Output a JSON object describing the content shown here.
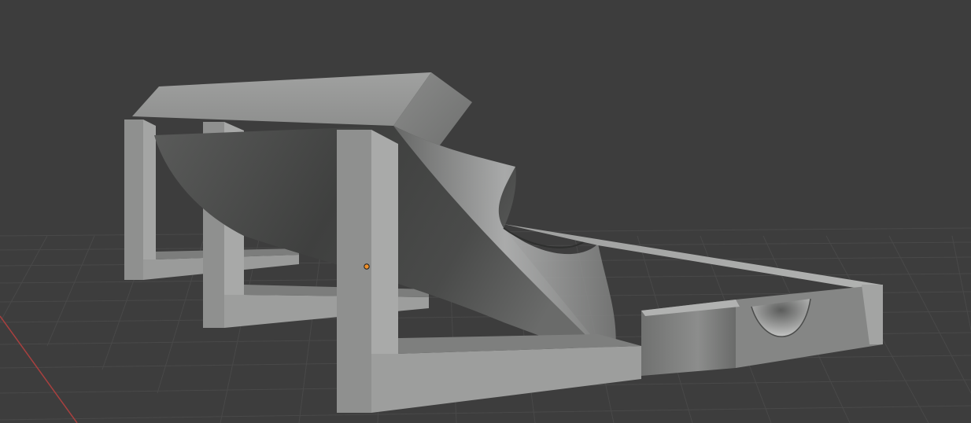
{
  "app": {
    "name": "",
    "viewport_background": "#3d3d3d",
    "grid_color": "#4a4a4a",
    "x_axis_color": "#a8403f",
    "origin_color": "#f0902a",
    "object_color": "#9b9c9b",
    "object_shade_dark": "#3c3c3c"
  },
  "scene": {
    "object": "model",
    "elements": [
      "grid-floor",
      "x-axis-line",
      "support-frame-rear",
      "support-frame-middle",
      "support-frame-front",
      "top-beam",
      "curved-trough",
      "holder-tray",
      "object-origin"
    ]
  }
}
